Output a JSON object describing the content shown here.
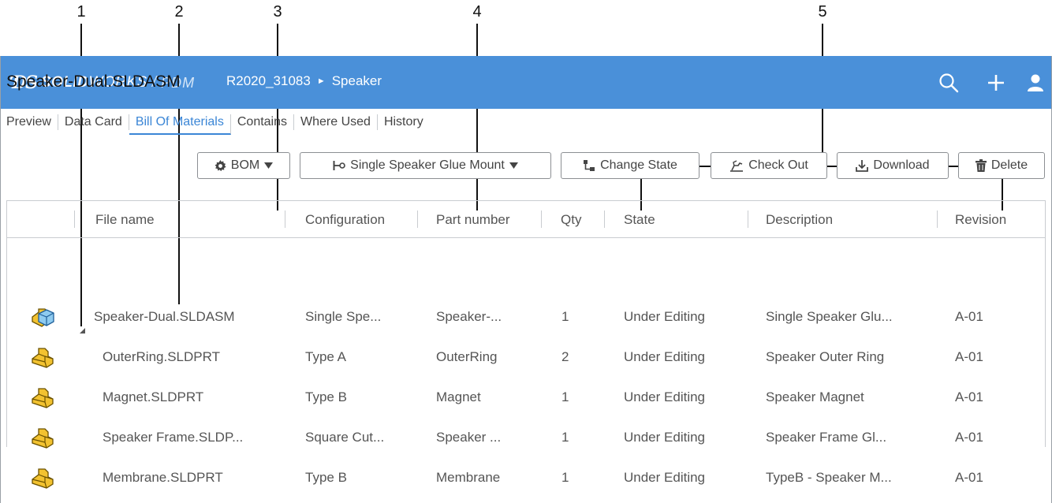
{
  "callouts": [
    "1",
    "2",
    "3",
    "4",
    "5"
  ],
  "app": {
    "brand_logo": "ƊS",
    "brand_solid": "SOLID",
    "brand_works": "WORKS",
    "brand_sep": "/",
    "brand_pdm": "PDM",
    "breadcrumb": [
      "R2020_31083",
      "Speaker"
    ],
    "breadcrumb_arrow": "►"
  },
  "file_title": "Speaker-Dual.SLDASM",
  "tabs": [
    "Preview",
    "Data Card",
    "Bill Of Materials",
    "Contains",
    "Where Used",
    "History"
  ],
  "active_tab": "Bill Of Materials",
  "toolbar": {
    "bom_label": "BOM",
    "config_label": "Single Speaker Glue Mount",
    "change_state_label": "Change State",
    "check_out_label": "Check Out",
    "download_label": "Download",
    "delete_label": "Delete"
  },
  "table": {
    "columns": [
      "File name",
      "Configuration",
      "Part number",
      "Qty",
      "State",
      "Description",
      "Revision"
    ],
    "rows": [
      {
        "icon": "assembly-icon",
        "file": "Speaker-Dual.SLDASM",
        "config": "Single Spe...",
        "part": "Speaker-...",
        "qty": "1",
        "state": "Under Editing",
        "desc": "Single Speaker Glu...",
        "rev": "A-01"
      },
      {
        "icon": "part-icon",
        "file": "OuterRing.SLDPRT",
        "config": "Type A",
        "part": "OuterRing",
        "qty": "2",
        "state": "Under Editing",
        "desc": "Speaker Outer Ring",
        "rev": "A-01"
      },
      {
        "icon": "part-icon",
        "file": "Magnet.SLDPRT",
        "config": "Type B",
        "part": "Magnet",
        "qty": "1",
        "state": "Under Editing",
        "desc": "Speaker Magnet",
        "rev": "A-01"
      },
      {
        "icon": "part-icon",
        "file": "Speaker Frame.SLDP...",
        "config": "Square Cut...",
        "part": "Speaker ...",
        "qty": "1",
        "state": "Under Editing",
        "desc": "Speaker Frame Gl...",
        "rev": "A-01"
      },
      {
        "icon": "part-icon",
        "file": "Membrane.SLDPRT",
        "config": "Type B",
        "part": "Membrane",
        "qty": "1",
        "state": "Under Editing",
        "desc": "TypeB - Speaker M...",
        "rev": "A-01"
      }
    ]
  },
  "colors": {
    "topbar": "#4a90d9",
    "accent": "#3b86d6",
    "part_icon": "#f2c230"
  }
}
